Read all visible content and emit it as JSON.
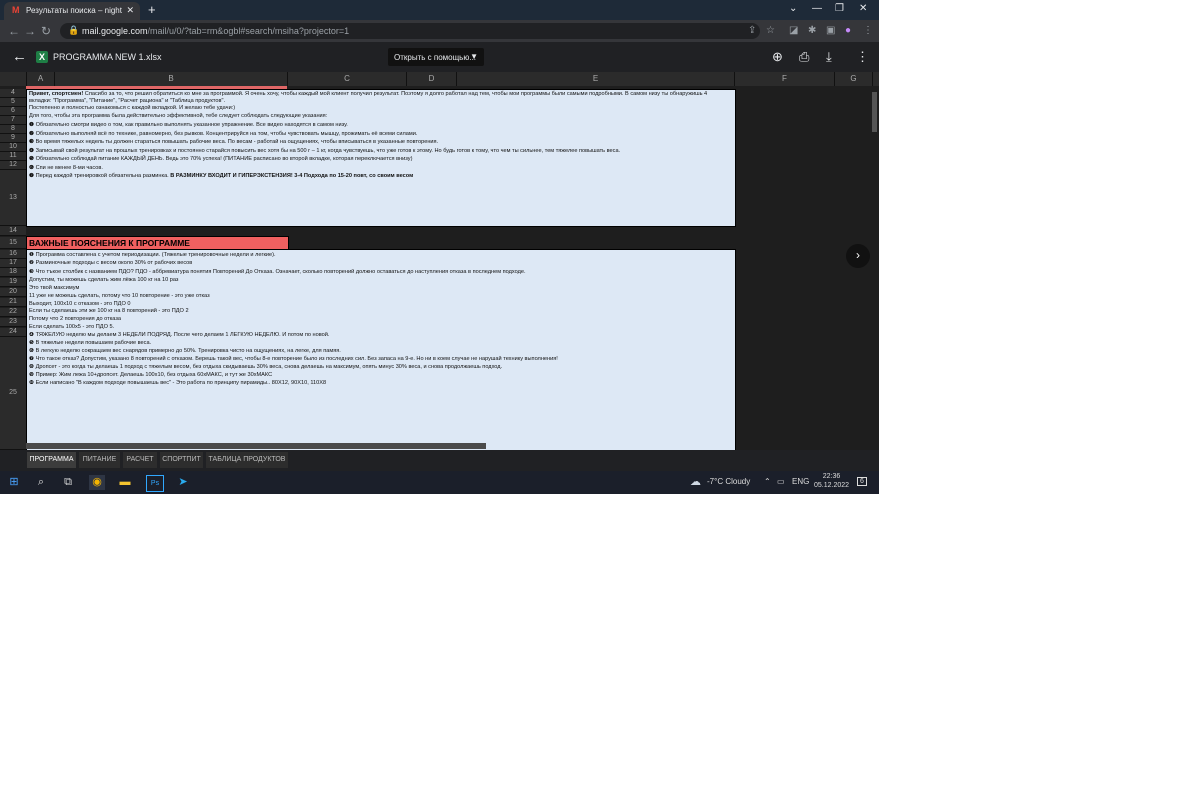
{
  "browser": {
    "tab_title": "Результаты поиска – nightcrawler",
    "favicon": "M",
    "url_host": "mail.google.com",
    "url_path": "/mail/u/0/?tab=rm&ogbl#search/msiha?projector=1",
    "new_tab": "+"
  },
  "viewer": {
    "file_name": "PROGRAMMA NEW 1.xlsx",
    "file_icon": "X",
    "open_with": "Открыть с помощью..."
  },
  "columns": [
    "A",
    "B",
    "C",
    "D",
    "E",
    "F",
    "G"
  ],
  "rows": [
    "4",
    "5",
    "6",
    "7",
    "8",
    "9",
    "10",
    "11",
    "12",
    "13",
    "14",
    "15",
    "16",
    "17",
    "18",
    "19",
    "20",
    "21",
    "22",
    "23",
    "24",
    "25"
  ],
  "box1_lines": [
    {
      "bold": "Привет, спортсмен!",
      "text": " Спасибо за то, что решил обратиться ко мне за программой. Я очень хочу, чтобы каждый мой клиент получил результат. Поэтому я долго работал над тем, чтобы мои программы были самыми подробными. В самом низу ты обнаружишь 4"
    },
    {
      "bold": "",
      "text": "вкладки: \"Программа\", \"Питание\", \"Расчет рациона\" и \"Таблица продуктов\"."
    },
    {
      "bold": "",
      "text": "Постепенно и полностью ознакомься с каждой вкладкой. И желаю тебе удачи:)"
    },
    {
      "bold": "",
      "text": "Для того, чтобы эта программа была действительно эффективной, тебе следует соблюдать следующие указания:"
    },
    {
      "bold": "❶",
      "text": " Обязательно смотри видео о том, как правильно выполнять указанное упражнение. Все видео находятся в самом низу."
    },
    {
      "bold": "❷",
      "text": " Обязательно выполняй всё по технике, равномерно, без рывков. Концентрируйся на том, чтобы чувствовать мышцу, прожимать её всеми силами."
    },
    {
      "bold": "❸",
      "text": " Во время тяжелых недель ты должен стараться повышать рабочие веса. По весам - работай на ощущениях, чтобы вписываться в указанные повторения."
    },
    {
      "bold": "❹",
      "text": " Записывай свой результат на прошлых тренировках и постоянно старайся повысить вес хотя бы на 500 г – 1 кг, когда чувствуешь, что уже готов к этому. Но будь готов к тому, что чем ты сильнее, тем тяжелее повышать веса."
    },
    {
      "bold": "❺",
      "text": " Обязательно соблюдай питание КАЖДЫЙ ДЕНЬ. Ведь это 70% успеха! (ПИТАНИЕ расписано во второй вкладке, которая переключается внизу)"
    },
    {
      "bold": "❻",
      "text": " Спи не менее 8-ми часов."
    },
    {
      "bold": "❼",
      "text": " Перед каждой тренировкой обязательна разминка. ",
      "tail": "В РАЗМИНКУ ВХОДИТ И ГИПЕРЭКСТЕНЗИЯ! 3-4 Подхода по 15-20 повт, со своим весом"
    }
  ],
  "heading": "ВАЖНЫЕ ПОЯСНЕНИЯ К ПРОГРАММЕ",
  "box2_lines": [
    "❶ Программа составлена с учетом периодизации. (Тяжелые тренировочные недели и легкие).",
    "❷ Разминочные подходы с весом около 30% от рабочих весов",
    "❸ Что тъкое столбик с названием ПДО? ПДО - аббревиатура понятия Повторений До Отказа. Означает, сколько повторений должно оставаться до наступления отказа в последнем подходе.",
    "Допустим, ты можешь сделать жим лёжа 100 кг на 10 раз",
    "Это твой максимум",
    "11 уже не можешь сделать, потому что 10 повторение - это уже отказ",
    "Выходит, 100х10 с отказом - это ПДО 0",
    "Если ты сделаешь эти же 100 кг на 8 повторений - это ПДО 2",
    "Потому что 2 повторения до отказа",
    "Если сделать 100х5 - это ПДО 5.",
    "❹ ТЯЖЕЛУЮ неделю мы делаем 3 НЕДЕЛИ ПОДРЯД. После чего делаем 1 ЛЕГКУЮ НЕДЕЛЮ. И потом по новой.",
    "❺ В тяжелые недели повышаем рабочие веса.",
    "❻ В легкую неделю сокращаем вес снарядов примерно до 50%. Тренировка чисто на ощущениях, на легке, для памяя.",
    "❼ Что такое отказ? Допустим, указано 8 повторений с отказом. Берешь такой вес, чтобы 8-е повторение было из последних сил. Без запаса на 9-е. Но ни в коем случае не нарушай технику выполнения!",
    "❽ Дропсет - это когда ты делаешь 1 подход с тяжелым весом, без отдыха скидываешь 30% веса, снова делаешь на максимум, опять минус 30% веса, и снова продолжаешь подход.",
    "❾ Пример: Жим лежа 10+дропсет. Делаешь 100х10, без отдыха 60хМАКС, и тут же 30хМАКС",
    "❿ Если написано \"В каждом подходе повышаешь вес\" - Это работа по принципу пирамиды.. 80Х12, 90Х10, 110Х8"
  ],
  "sheet_tabs": [
    "ПРОГРАММА",
    "ПИТАНИЕ",
    "РАСЧЕТ",
    "СПОРТПИТ",
    "ТАБЛИЦА ПРОДУКТОВ"
  ],
  "taskbar": {
    "weather": "-7°C  Cloudy",
    "lang": "ENG",
    "time": "22:36",
    "date": "05.12.2022",
    "notif": "6"
  }
}
